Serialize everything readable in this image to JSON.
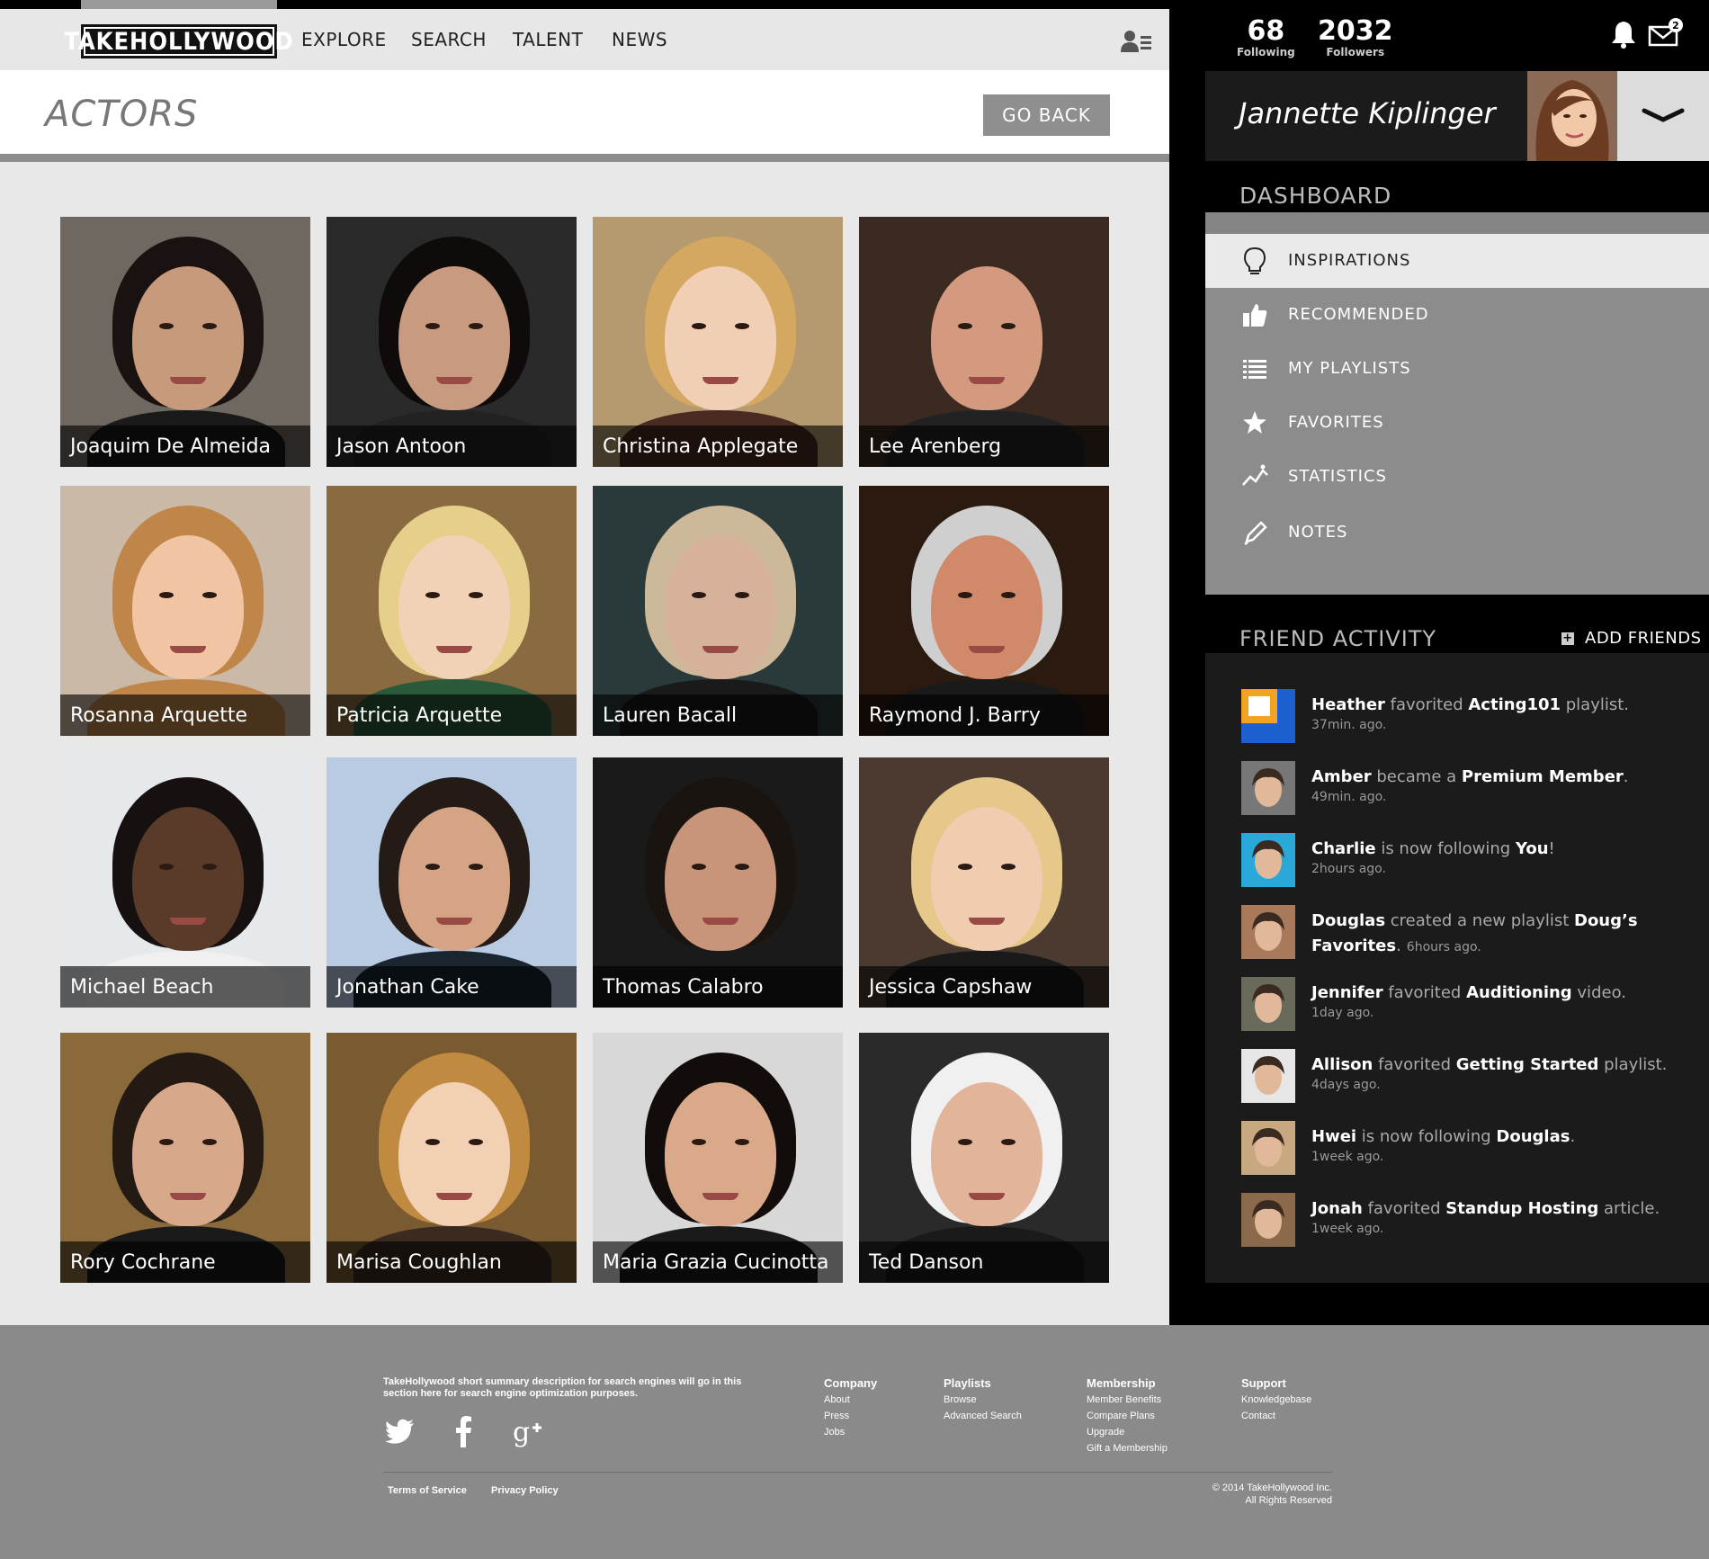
{
  "brand": {
    "logo_text": "TAKEHOLLYWOOD"
  },
  "nav": {
    "items": [
      "EXPLORE",
      "SEARCH",
      "TALENT",
      "NEWS"
    ]
  },
  "page": {
    "title": "ACTORS",
    "go_back_label": "GO BACK"
  },
  "actors": [
    "Joaquim De Almeida",
    "Jason Antoon",
    "Christina Applegate",
    "Lee Arenberg",
    "Rosanna Arquette",
    "Patricia Arquette",
    "Lauren Bacall",
    "Raymond J. Barry",
    "Michael Beach",
    "Jonathan Cake",
    "Thomas Calabro",
    "Jessica Capshaw",
    "Rory Cochrane",
    "Marisa Coughlan",
    "Maria Grazia Cucinotta",
    "Ted Danson"
  ],
  "user": {
    "following_count": "68",
    "following_label": "Following",
    "followers_count": "2032",
    "followers_label": "Followers",
    "name": "Jannette Kiplinger",
    "mail_badge": "2"
  },
  "dashboard": {
    "title": "DASHBOARD",
    "items": [
      "INSPIRATIONS",
      "RECOMMENDED",
      "MY PLAYLISTS",
      "FAVORITES",
      "STATISTICS",
      "NOTES"
    ]
  },
  "friend_activity": {
    "title": "FRIEND ACTIVITY",
    "add_friends_label": "ADD FRIENDS",
    "items": [
      {
        "who": "Heather",
        "verb": " favorited ",
        "what": "Acting101",
        "tail": " playlist.",
        "time": "37min. ago."
      },
      {
        "who": "Amber",
        "verb": " became a ",
        "what": "Premium Member",
        "tail": ".",
        "time": "49min. ago."
      },
      {
        "who": "Charlie",
        "verb": " is now following ",
        "what": "You",
        "tail": "!",
        "time": "2hours ago."
      },
      {
        "who": "Douglas",
        "verb": " created a new playlist ",
        "what": "Doug’s Favorites",
        "tail": ".",
        "time": "6hours ago."
      },
      {
        "who": "Jennifer",
        "verb": " favorited ",
        "what": "Auditioning",
        "tail": " video.",
        "time": "1day ago."
      },
      {
        "who": "Allison",
        "verb": " favorited ",
        "what": "Getting Started",
        "tail": " playlist.",
        "time": "4days ago."
      },
      {
        "who": "Hwei",
        "verb": " is now following ",
        "what": "Douglas",
        "tail": ".",
        "time": "1week ago."
      },
      {
        "who": "Jonah",
        "verb": " favorited ",
        "what": "Standup Hosting",
        "tail": " article.",
        "time": "1week ago."
      }
    ]
  },
  "footer": {
    "description": "TakeHollywood short summary description for  search engines will go in this section here for search engine optimization purposes.",
    "columns": [
      {
        "heading": "Company",
        "links": [
          "About",
          "Press",
          "Jobs"
        ]
      },
      {
        "heading": "Playlists",
        "links": [
          "Browse",
          "Advanced Search"
        ]
      },
      {
        "heading": "Membership",
        "links": [
          "Member Benefits",
          "Compare Plans",
          "Upgrade",
          "Gift a Membership"
        ]
      },
      {
        "heading": "Support",
        "links": [
          "Knowledgebase",
          "Contact"
        ]
      }
    ],
    "terms_label": "Terms of Service",
    "privacy_label": "Privacy Policy",
    "copyright_line1": "© 2014 TakeHollywood Inc.",
    "copyright_line2": "All Rights Reserved"
  },
  "colors": {
    "sidebar_bg": "#000000",
    "panel_gray": "#8c8c8c",
    "active_row": "#e9eae9",
    "footer_bg": "#8a8a8a"
  }
}
